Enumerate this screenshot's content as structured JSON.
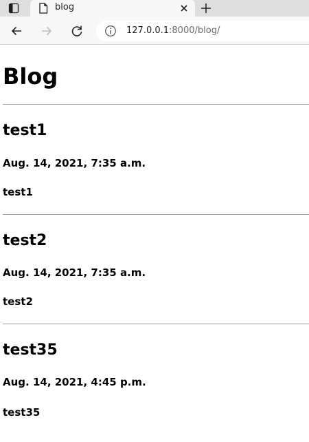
{
  "browser": {
    "tab": {
      "title": "blog"
    },
    "address_bar": {
      "url_host": "127.0.0.1",
      "url_rest": ":8000/blog/"
    },
    "icons": {
      "tab_actions": "tab-actions-icon",
      "favicon": "page-icon",
      "close": "close-icon",
      "new_tab": "plus-icon",
      "back": "arrow-left-icon",
      "forward": "arrow-right-icon",
      "reload": "reload-icon",
      "site_info": "info-icon"
    }
  },
  "page": {
    "heading": "Blog",
    "posts": [
      {
        "title": "test1",
        "date": "Aug. 14, 2021, 7:35 a.m.",
        "body": "test1"
      },
      {
        "title": "test2",
        "date": "Aug. 14, 2021, 7:35 a.m.",
        "body": "test2"
      },
      {
        "title": "test35",
        "date": "Aug. 14, 2021, 4:45 p.m.",
        "body": "test35"
      }
    ]
  }
}
